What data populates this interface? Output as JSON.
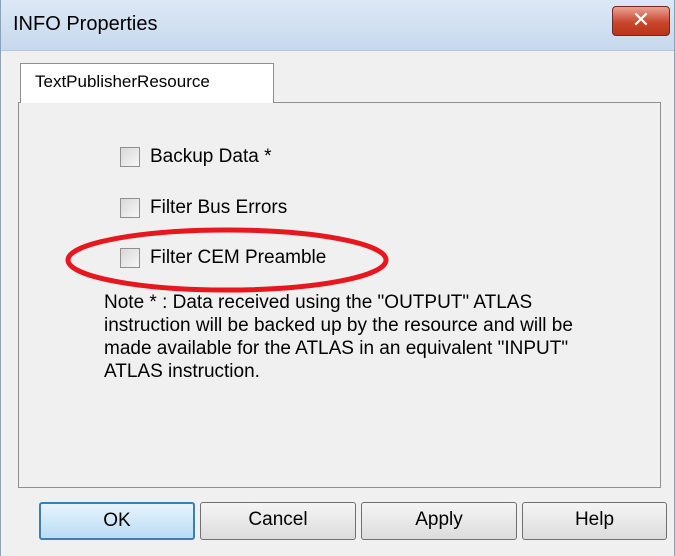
{
  "window": {
    "title": "INFO Properties",
    "close_glyph": "✕"
  },
  "tabs": [
    {
      "label": "TextPublisherResource",
      "active": true
    }
  ],
  "checkboxes": [
    {
      "label": "Backup Data *",
      "checked": false
    },
    {
      "label": "Filter Bus Errors",
      "checked": false
    },
    {
      "label": "Filter CEM Preamble",
      "checked": false,
      "highlighted": true
    }
  ],
  "note": "Note * : Data received using the \"OUTPUT\" ATLAS instruction will be backed up by the resource and will be made available for the ATLAS in an equivalent \"INPUT\" ATLAS instruction.",
  "buttons": {
    "ok": "OK",
    "cancel": "Cancel",
    "apply": "Apply",
    "help": "Help"
  },
  "colors": {
    "highlight_ellipse": "#e8161d",
    "close_button": "#c9462c",
    "default_button_border": "#3c7fb1"
  },
  "icons": {
    "close": "close-icon",
    "checkbox": "checkbox-icon"
  }
}
